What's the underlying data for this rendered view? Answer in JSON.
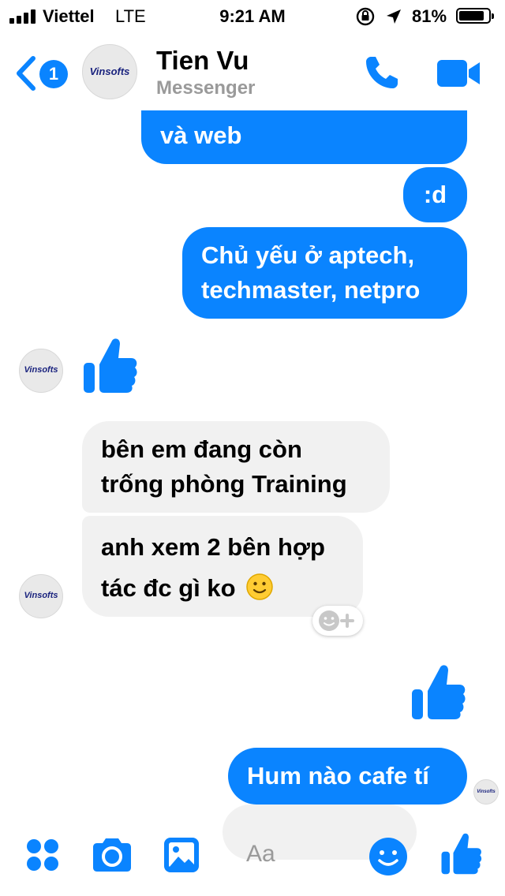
{
  "status_bar": {
    "carrier": "Viettel",
    "network": "LTE",
    "time": "9:21 AM",
    "battery": "81%"
  },
  "header": {
    "back_count": "1",
    "contact_name": "Tien Vu",
    "subtitle": "Messenger",
    "avatar_text": "Vinsofts"
  },
  "messages": [
    {
      "from": "me",
      "text": "và web"
    },
    {
      "from": "me",
      "text": ":d"
    },
    {
      "from": "me",
      "lines": [
        "Chủ yếu ở aptech,",
        "techmaster, netpro"
      ]
    },
    {
      "from": "them",
      "type": "like-icon"
    },
    {
      "from": "them",
      "lines": [
        "bên em đang còn",
        "trống phòng Training"
      ]
    },
    {
      "from": "them",
      "lines": [
        "anh xem 2 bên hợp",
        "tác đc gì ko"
      ]
    },
    {
      "from": "me",
      "type": "like-icon"
    },
    {
      "from": "me",
      "text": "Hum nào cafe tí"
    }
  ],
  "composer": {
    "placeholder": "Aa"
  },
  "colors": {
    "accent": "#0a84ff",
    "incoming_bubble": "#f1f1f1",
    "subtitle_gray": "#9a9a9a"
  }
}
